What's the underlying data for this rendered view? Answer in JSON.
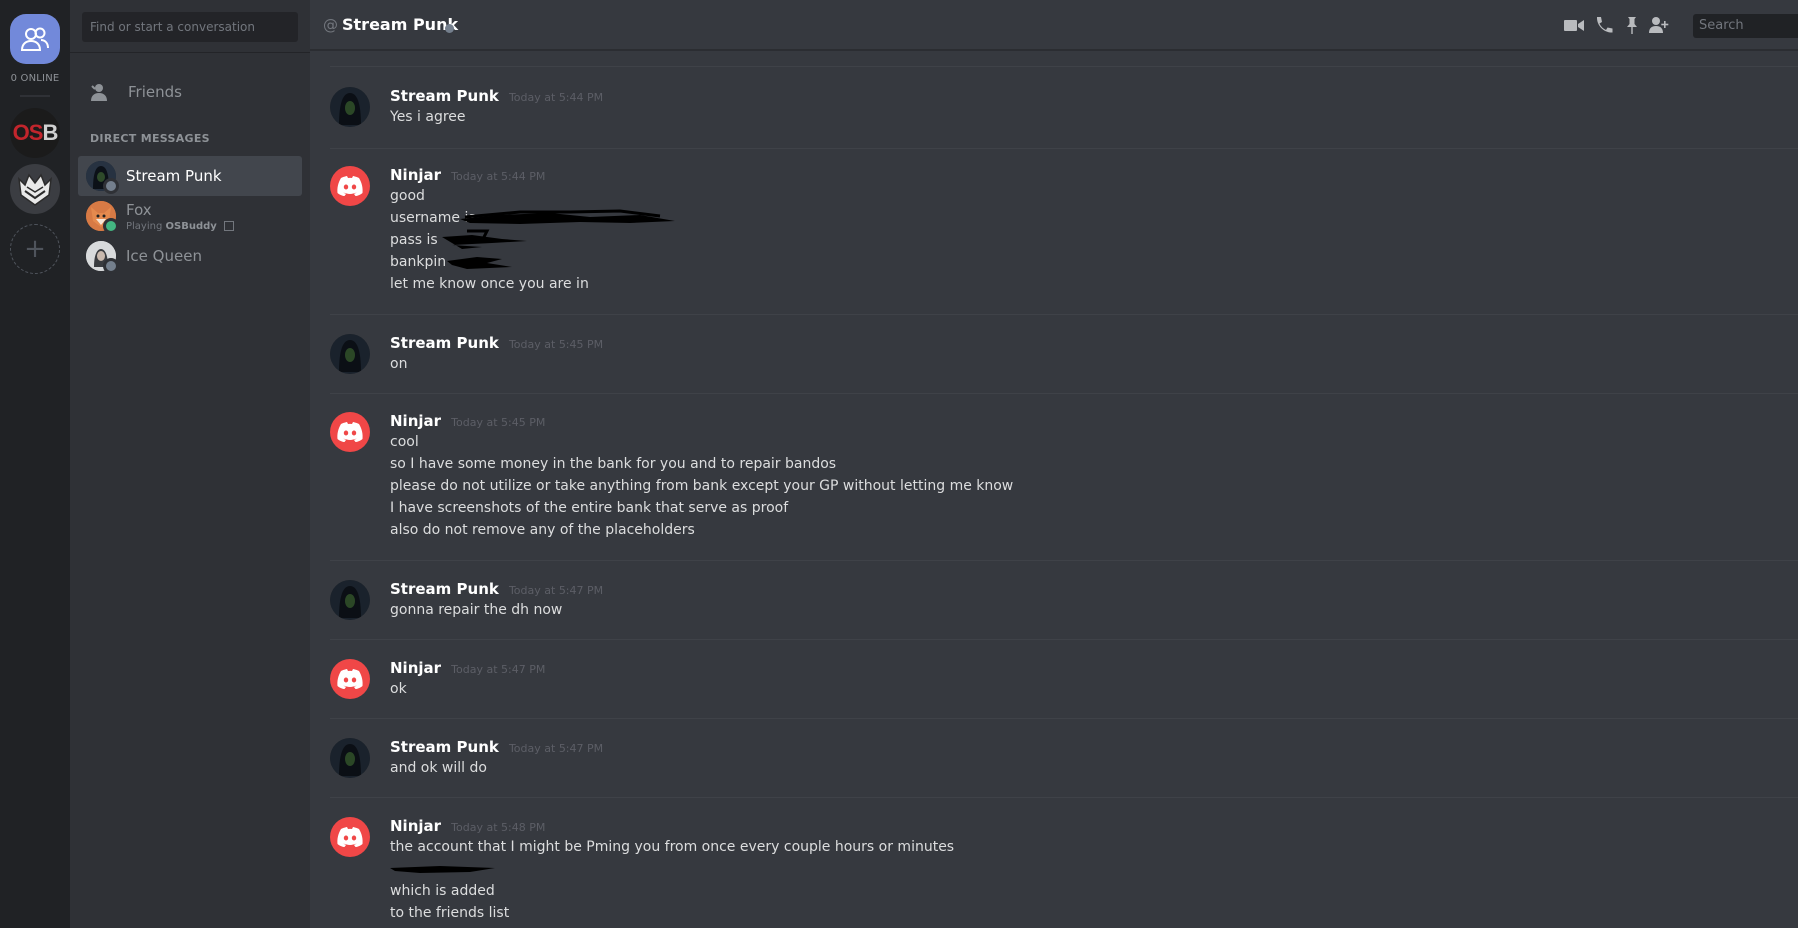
{
  "rail": {
    "online_count": "0 ONLINE",
    "servers": [
      {
        "name": "OSB",
        "os": "OS",
        "b": "B"
      },
      {
        "name": "shield-server"
      }
    ]
  },
  "dm": {
    "search_placeholder": "Find or start a conversation",
    "friends_label": "Friends",
    "header": "DIRECT MESSAGES",
    "items": [
      {
        "name": "Stream Punk",
        "status_color": "#747f8d"
      },
      {
        "name": "Fox",
        "sub_prefix": "Playing ",
        "sub_game": "OSBuddy",
        "status_color": "#43b581"
      },
      {
        "name": "Ice Queen",
        "status_color": "#747f8d"
      }
    ]
  },
  "header": {
    "at": "@",
    "title": "Stream Punk",
    "search_placeholder": "Search"
  },
  "messages": [
    {
      "author": "Stream Punk",
      "timestamp": "Today at 5:44 PM",
      "lines": [
        "Yes i agree"
      ]
    },
    {
      "author": "Ninjar",
      "timestamp": "Today at 5:44 PM",
      "lines": [
        "good",
        "username is",
        "pass is",
        "bankpin",
        "let me know once you are in"
      ]
    },
    {
      "author": "Stream Punk",
      "timestamp": "Today at 5:45 PM",
      "lines": [
        "on"
      ]
    },
    {
      "author": "Ninjar",
      "timestamp": "Today at 5:45 PM",
      "lines": [
        "cool",
        "so I have some money in the bank for you and to repair bandos",
        "please do not utilize or take anything from bank except your GP without letting me know",
        "I have screenshots of the entire bank that serve as proof",
        "also do not remove any of the placeholders"
      ]
    },
    {
      "author": "Stream Punk",
      "timestamp": "Today at 5:47 PM",
      "lines": [
        "gonna repair the dh now"
      ]
    },
    {
      "author": "Ninjar",
      "timestamp": "Today at 5:47 PM",
      "lines": [
        "ok"
      ]
    },
    {
      "author": "Stream Punk",
      "timestamp": "Today at 5:47 PM",
      "lines": [
        "and ok will do"
      ]
    },
    {
      "author": "Ninjar",
      "timestamp": "Today at 5:48 PM",
      "lines": [
        "the account that I might be Pming you from once every couple hours or minutes",
        "",
        "which is added",
        "to the friends list"
      ]
    }
  ],
  "colors": {
    "ninjar_avatar": "#f04747",
    "blurple": "#7289da",
    "online": "#43b581",
    "offline": "#747f8d"
  }
}
